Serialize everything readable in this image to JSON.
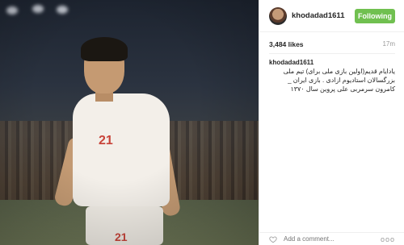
{
  "post": {
    "username": "khodadad1611",
    "follow_label": "Following",
    "likes": "3,484 likes",
    "age": "17m",
    "caption_user": "khodadad1611",
    "caption_text": "یادایام قدیم(اولین بازی ملی برای) تیم ملی بزرگسالان استادیوم ازادی . بازی ایران _ کامرون سرمربی علی پروین سال ۱۳۷۰",
    "comment_placeholder": "Add a comment...",
    "more_glyph": "ooo"
  },
  "photo": {
    "jersey_number": "21",
    "shorts_number": "21"
  },
  "colors": {
    "follow_button": "#70c050",
    "jersey_number": "#c8443a"
  },
  "icons": {
    "like": "heart-icon",
    "more": "more-options-icon",
    "avatar": "avatar"
  }
}
